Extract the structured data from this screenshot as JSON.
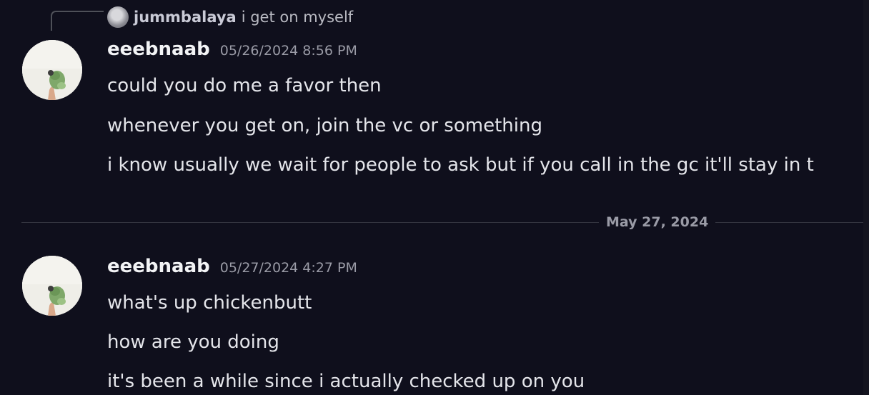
{
  "reply": {
    "author": "jummbalaya",
    "text": "i get on myself"
  },
  "messages": [
    {
      "author": "eeebnaab",
      "timestamp": "05/26/2024 8:56 PM",
      "lines": [
        "could you do me a favor then",
        "whenever you get on, join the vc or something",
        "i know usually we wait for people to ask but if you call in the gc it'll stay in t"
      ]
    },
    {
      "author": "eeebnaab",
      "timestamp": "05/27/2024 4:27 PM",
      "lines": [
        "what's up chickenbutt",
        "how are you doing",
        "it's been a while since i actually checked up on you"
      ]
    }
  ],
  "date_divider": "May 27, 2024",
  "icons": {
    "reply_avatar": "user-avatar-icon",
    "message_avatar": "frog-figure-avatar"
  }
}
